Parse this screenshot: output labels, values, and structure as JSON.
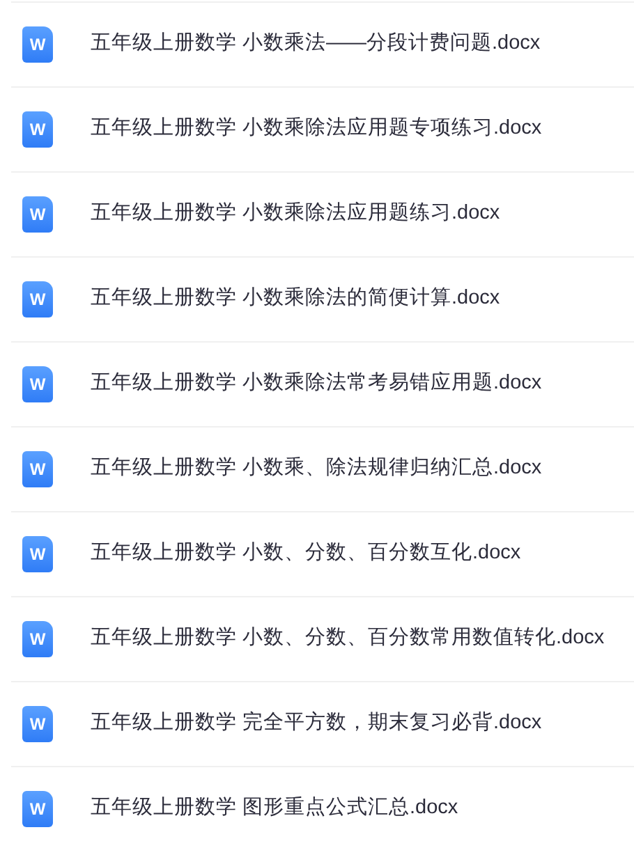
{
  "files": [
    {
      "icon_letter": "W",
      "name": "五年级上册数学 小数乘法——分段计费问题.docx"
    },
    {
      "icon_letter": "W",
      "name": "五年级上册数学 小数乘除法应用题专项练习.docx"
    },
    {
      "icon_letter": "W",
      "name": "五年级上册数学 小数乘除法应用题练习.docx"
    },
    {
      "icon_letter": "W",
      "name": "五年级上册数学 小数乘除法的简便计算.docx"
    },
    {
      "icon_letter": "W",
      "name": "五年级上册数学 小数乘除法常考易错应用题.docx"
    },
    {
      "icon_letter": "W",
      "name": "五年级上册数学 小数乘、除法规律归纳汇总.docx"
    },
    {
      "icon_letter": "W",
      "name": "五年级上册数学 小数、分数、百分数互化.docx"
    },
    {
      "icon_letter": "W",
      "name": "五年级上册数学 小数、分数、百分数常用数值转化.docx"
    },
    {
      "icon_letter": "W",
      "name": "五年级上册数学 完全平方数，期末复习必背.docx"
    },
    {
      "icon_letter": "W",
      "name": "五年级上册数学 图形重点公式汇总.docx"
    }
  ]
}
